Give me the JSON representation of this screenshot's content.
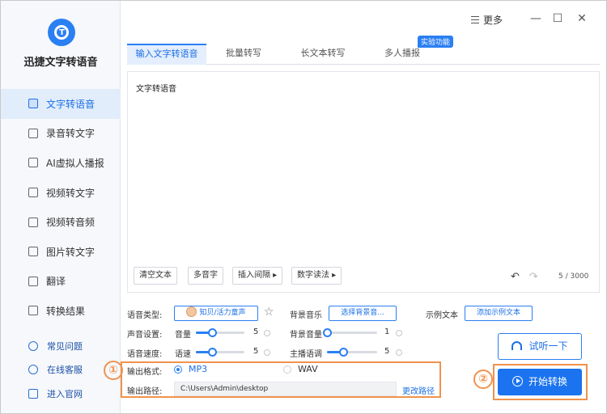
{
  "app": {
    "title": "迅捷文字转语音"
  },
  "topbar": {
    "more_label": "更多",
    "minimize": "—",
    "maximize": "☐",
    "close": "✕"
  },
  "sidebar": {
    "items": [
      {
        "label": "文字转语音",
        "active": true
      },
      {
        "label": "录音转文字"
      },
      {
        "label": "AI虚拟人播报"
      },
      {
        "label": "视频转文字"
      },
      {
        "label": "视频转音频"
      },
      {
        "label": "图片转文字"
      },
      {
        "label": "翻译"
      },
      {
        "label": "转换结果"
      }
    ],
    "bottom_links": [
      "常见问题",
      "在线客服",
      "进入官网"
    ]
  },
  "tabs": [
    {
      "label": "输入文字转语音",
      "active": true
    },
    {
      "label": "批量转写"
    },
    {
      "label": "长文本转写"
    },
    {
      "label": "多人播报"
    }
  ],
  "tab_badge": "实验功能",
  "editor": {
    "text": "文字转语音",
    "tools": [
      "清空文本",
      "多音字",
      "插入间隔 ▸",
      "数字读法 ▸"
    ],
    "count": "5 / 3000"
  },
  "settings": {
    "voice_type_label": "语音类型:",
    "voice_name": "知贝/活力童声",
    "bg_music_label": "背景音乐",
    "bg_music_button": "选择背景音...",
    "sample_label": "示例文本",
    "sample_button": "添加示例文本",
    "sound_label": "声音设置:",
    "volume_label": "音量",
    "volume_value": "5",
    "volume_level": 0.33,
    "bg_volume_label": "背景音量",
    "bg_volume_value": "1",
    "bg_volume_level": 0.0,
    "speed_label": "语音速度:",
    "speed_sub": "语速",
    "speed_value": "5",
    "speed_level": 0.33,
    "pitch_label": "主播语调",
    "pitch_value": "5",
    "pitch_level": 0.33
  },
  "output": {
    "format_label": "输出格式:",
    "formats": [
      {
        "label": "MP3",
        "selected": true
      },
      {
        "label": "WAV",
        "selected": false
      }
    ],
    "path_label": "输出路径:",
    "path_value": "C:\\Users\\Admin\\desktop",
    "change_path": "更改路径"
  },
  "actions": {
    "listen": "试听一下",
    "convert": "开始转换"
  },
  "markers": [
    "①",
    "②"
  ],
  "colors": {
    "accent": "#2a7ff3",
    "marker": "#f0924d"
  }
}
